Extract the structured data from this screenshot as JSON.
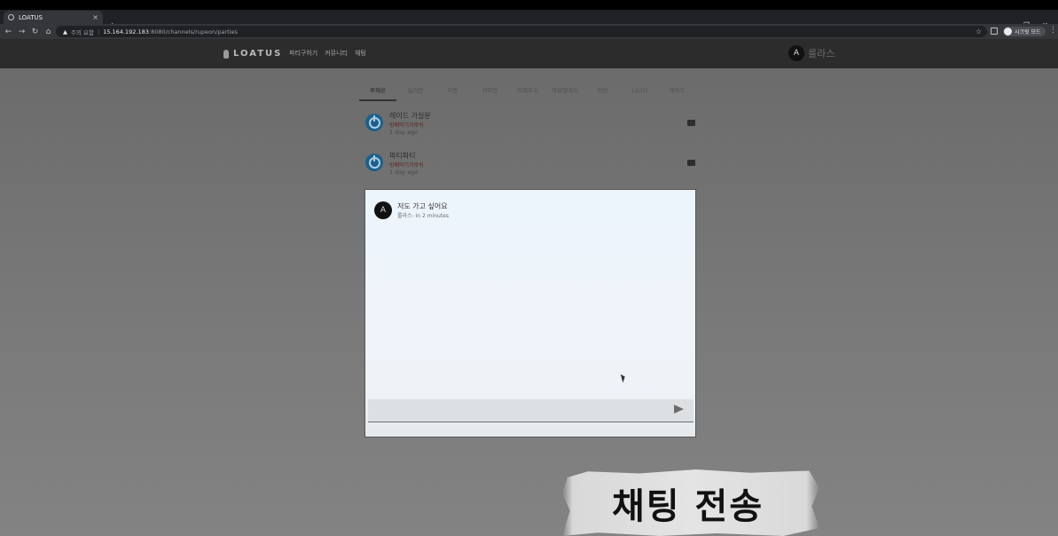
{
  "browser": {
    "tab_title": "LOATUS",
    "tab_close": "×",
    "new_tab": "+",
    "window_controls": [
      "⌄",
      "–",
      "❐",
      "✕"
    ],
    "nav_icons": [
      "back-icon",
      "forward-icon",
      "reload-icon",
      "home-icon"
    ],
    "security_label": "주의 요함",
    "url_host": "15.164.192.183",
    "url_rest": ":8080/channels/rupeon/parties",
    "profile_label": "시크릿 모드"
  },
  "app": {
    "logo": "LOATUS",
    "menu": [
      "파티구하기",
      "커뮤니티",
      "채팅"
    ],
    "user_avatar_letter": "A",
    "user_name": "룰라스"
  },
  "tabs": [
    {
      "label": "루페온",
      "active": true
    },
    {
      "label": "실리안",
      "active": false
    },
    {
      "label": "아만",
      "active": false
    },
    {
      "label": "카마인",
      "active": false
    },
    {
      "label": "카제로스",
      "active": false
    },
    {
      "label": "아브렐슈드",
      "active": false
    },
    {
      "label": "카단",
      "active": false
    },
    {
      "label": "니나브",
      "active": false
    },
    {
      "label": "레이드",
      "active": false
    }
  ],
  "posts": [
    {
      "title": "레이드 가실분",
      "author": "방패막기가로쉬",
      "time": "1 day ago"
    },
    {
      "title": "파티파티",
      "author": "방패막기가로쉬",
      "time": "1 day ago"
    }
  ],
  "chat": {
    "messages": [
      {
        "avatar_letter": "A",
        "text": "저도 가고 싶어요",
        "meta": "룰라스- in 2 minutes"
      }
    ],
    "input_placeholder": ""
  },
  "caption": {
    "text": "채팅 전송"
  }
}
